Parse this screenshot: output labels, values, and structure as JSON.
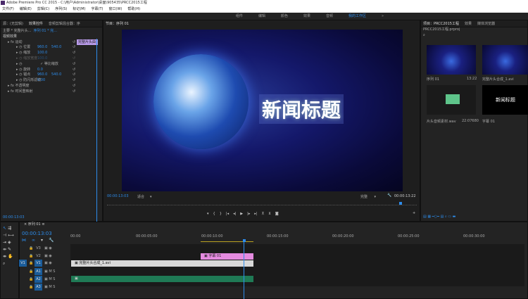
{
  "titlebar": {
    "title": "Adobe Premiere Pro CC 2015 - C:\\用户\\Administrator\\桌面\\905435\\PRCC2015工程"
  },
  "menu": [
    "文件(F)",
    "编辑(E)",
    "剪辑(C)",
    "序列(S)",
    "标记(M)",
    "字幕(T)",
    "窗口(W)",
    "帮助(H)"
  ],
  "workspace": {
    "items": [
      "组件",
      "编辑",
      "颜色",
      "效果",
      "音频"
    ],
    "active": "我的工作区"
  },
  "effect_controls": {
    "tabs": [
      "源：(无剪辑)",
      "效果控件",
      "音频剪辑混合器：序"
    ],
    "master": "主要 * 完整片头...",
    "sequence": "序列 01 * 完...",
    "clip_label": "完整片头由",
    "section": "视频效果",
    "rows": [
      {
        "label": "运动",
        "indent": 1
      },
      {
        "label": "位置",
        "v1": "960.0",
        "v2": "540.0"
      },
      {
        "label": "缩放",
        "v1": "100.0"
      },
      {
        "label": "缩放宽度",
        "v1": "100.0",
        "disabled": true
      },
      {
        "label": "等比缩放",
        "checkbox": true
      },
      {
        "label": "旋转",
        "v1": "0.0"
      },
      {
        "label": "锚点",
        "v1": "960.0",
        "v2": "540.0"
      },
      {
        "label": "防闪烁滤镜",
        "v1": "0.00"
      },
      {
        "label": "不透明度",
        "indent": 1
      },
      {
        "label": "时间重映射",
        "indent": 1
      }
    ],
    "timecode": "00:00:13:03"
  },
  "program": {
    "tab": "节目：序列 01",
    "headline": "新闻标题",
    "timecode": "00:00:13:03",
    "fit": "适合",
    "quality": "完整",
    "duration": "00:00:13:22"
  },
  "project": {
    "tabs": [
      "项目：PRCC2015工程",
      "效果",
      "媒体浏览器"
    ],
    "file": "PRCC2015工程.prproj",
    "items": [
      {
        "name": "序列 01",
        "duration": "13:22"
      },
      {
        "name": "完整片头合成_1.avi",
        "duration": ""
      },
      {
        "name": "片头音频素材.wav",
        "duration": "22:07680"
      },
      {
        "name": "字幕 01",
        "duration": "",
        "preview": "新闻标题"
      }
    ]
  },
  "timeline": {
    "tab": "序列 01",
    "timecode": "00:00:13:03",
    "ruler": [
      "00:00",
      "00:00:05:00",
      "00:00:10:00",
      "00:00:15:00",
      "00:00:20:00",
      "00:00:25:00",
      "00:00:30:00"
    ],
    "tracks": [
      "V3",
      "V2",
      "V1",
      "A1",
      "A2",
      "A3"
    ],
    "source_v": "V1",
    "clips": {
      "title": "字幕 01",
      "video": "完整片头合成_1.avi"
    },
    "colors": {
      "title": "#e58be0",
      "video": "#d8d8d8",
      "audio": "#1f7a55",
      "playhead": "#2d8ceb"
    }
  }
}
